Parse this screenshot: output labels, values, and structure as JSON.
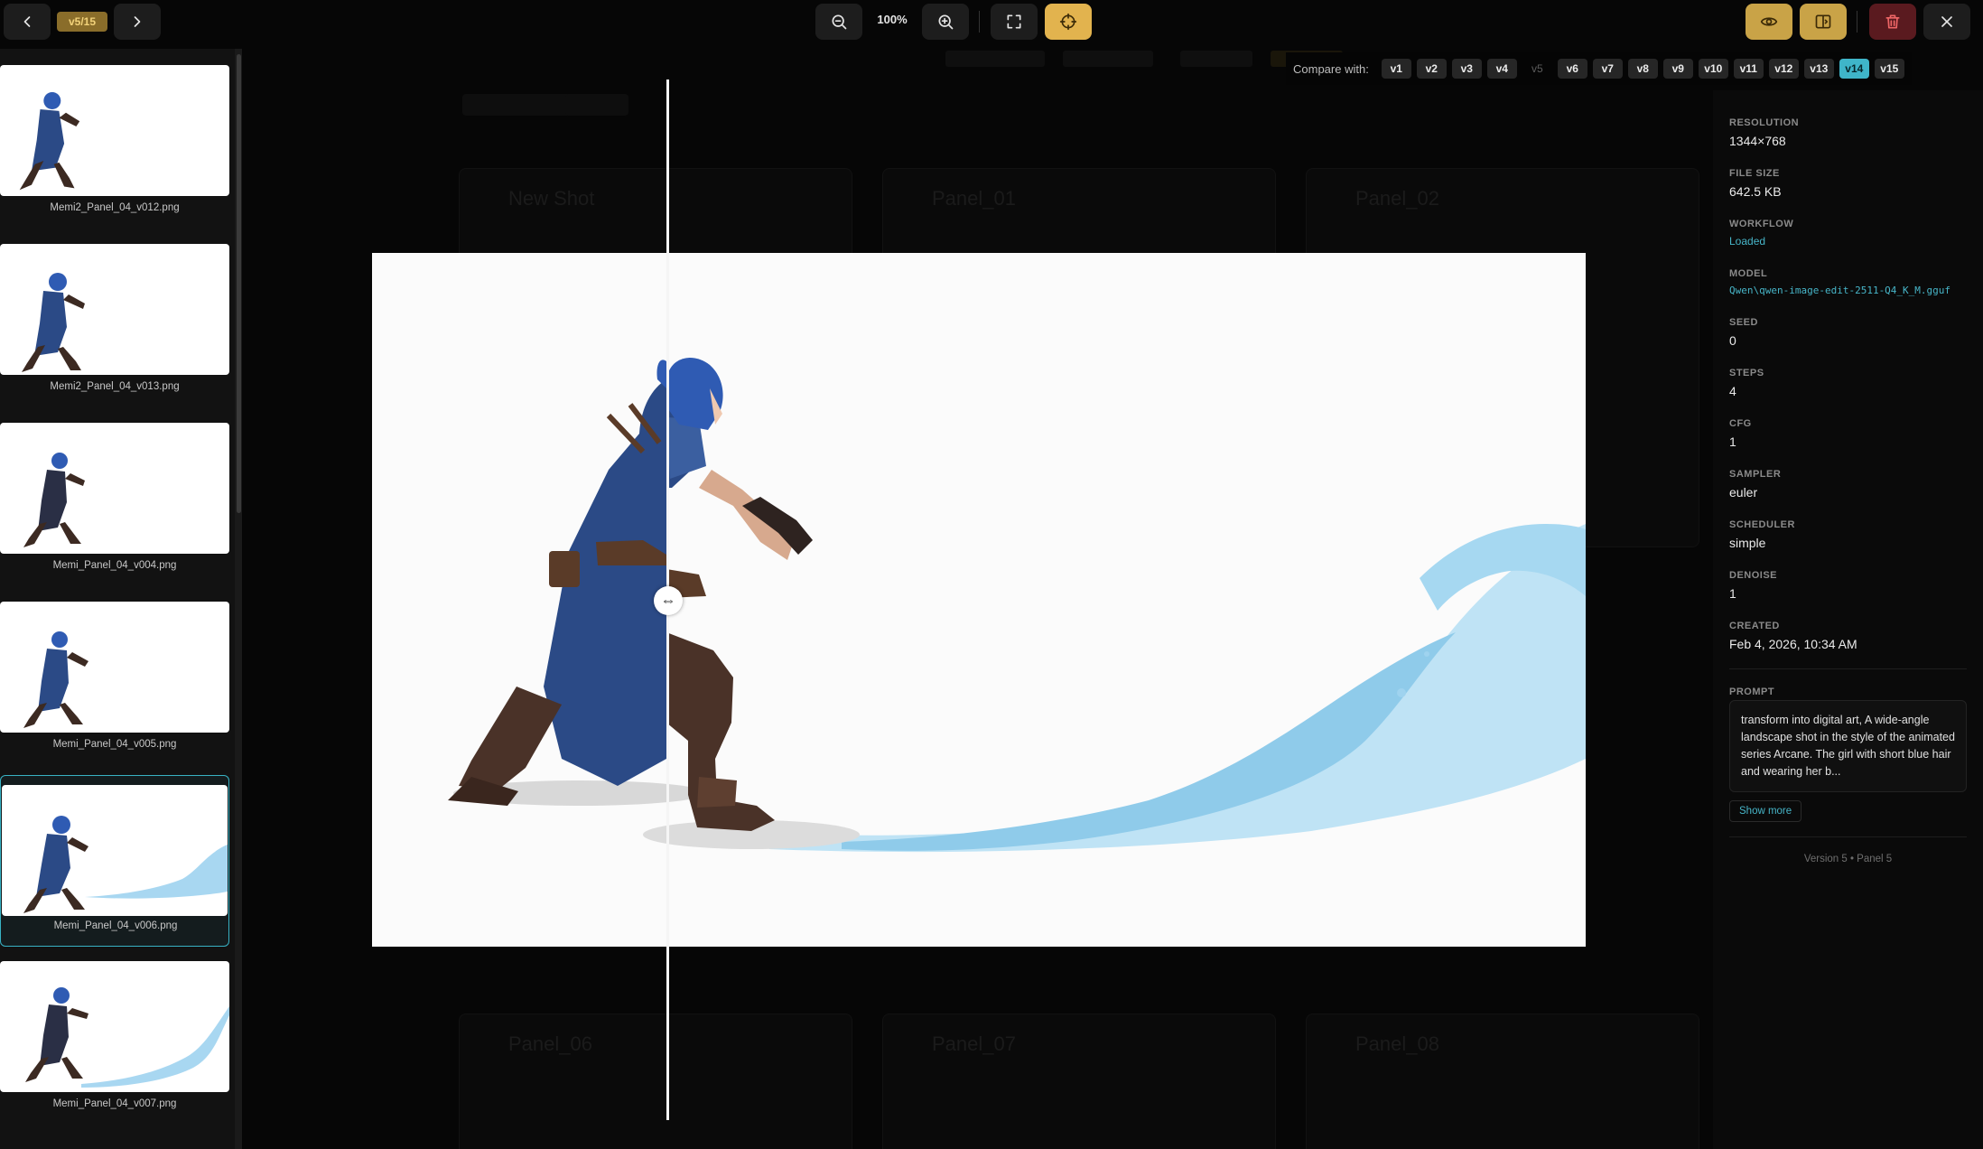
{
  "topbar": {
    "version_badge": "v5/15",
    "zoom_level": "100%"
  },
  "filmstrip": {
    "items": [
      {
        "filename": "Memi2_Panel_04_v012.png",
        "active": false
      },
      {
        "filename": "Memi2_Panel_04_v013.png",
        "active": false
      },
      {
        "filename": "Memi_Panel_04_v004.png",
        "active": false
      },
      {
        "filename": "Memi_Panel_04_v005.png",
        "active": false
      },
      {
        "filename": "Memi_Panel_04_v006.png",
        "active": true
      },
      {
        "filename": "Memi_Panel_04_v007.png",
        "active": false
      }
    ]
  },
  "compare": {
    "label": "Compare with:",
    "versions": [
      "v1",
      "v2",
      "v3",
      "v4",
      "v5",
      "v6",
      "v7",
      "v8",
      "v9",
      "v10",
      "v11",
      "v12",
      "v13",
      "v14",
      "v15"
    ],
    "current": "v5",
    "selected": "v14"
  },
  "info": {
    "resolution_label": "RESOLUTION",
    "resolution": "1344×768",
    "file_size_label": "FILE SIZE",
    "file_size": "642.5 KB",
    "workflow_label": "WORKFLOW",
    "workflow": "Loaded",
    "model_label": "MODEL",
    "model": "Qwen\\qwen-image-edit-2511-Q4_K_M.gguf",
    "seed_label": "SEED",
    "seed": "0",
    "steps_label": "STEPS",
    "steps": "4",
    "cfg_label": "CFG",
    "cfg": "1",
    "sampler_label": "SAMPLER",
    "sampler": "euler",
    "scheduler_label": "SCHEDULER",
    "scheduler": "simple",
    "denoise_label": "DENOISE",
    "denoise": "1",
    "created_label": "CREATED",
    "created": "Feb 4, 2026, 10:34 AM",
    "prompt_label": "PROMPT",
    "prompt": "transform into digital art, A wide-angle landscape shot in the style of the animated series Arcane. The girl with short blue hair and wearing her b...",
    "show_more": "Show more",
    "footer": "Version 5 • Panel 5"
  },
  "background": {
    "cards": [
      "New Shot",
      "Panel_01",
      "Panel_02",
      "Panel_06",
      "Panel_07",
      "Panel_08"
    ],
    "stars": "★★★★★"
  },
  "colors": {
    "accent": "#e2b34e",
    "teal": "#3fb5c9",
    "danger": "#5a1a1f",
    "hair_blue": "#2f5bb3",
    "coat_blue": "#2b4a86",
    "wave_blue": "#9fd3ef"
  },
  "icons": {
    "prev": "chevron-left-icon",
    "next": "chevron-right-icon",
    "zoom_out": "zoom-out-icon",
    "zoom_in": "zoom-in-icon",
    "fullscreen": "fullscreen-icon",
    "target": "crosshair-icon",
    "eye": "eye-icon",
    "compare": "split-view-icon",
    "delete": "trash-icon",
    "close": "close-icon",
    "divider": "left-right-arrow-icon"
  }
}
